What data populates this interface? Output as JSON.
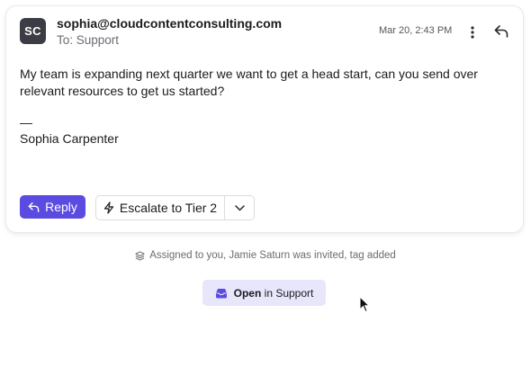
{
  "message": {
    "avatar_initials": "SC",
    "sender_email": "sophia@cloudcontentconsulting.com",
    "recipient": "To: Support",
    "timestamp": "Mar 20, 2:43 PM",
    "body": "My team is expanding next quarter we want to get a head start, can you send over relevant resources to get us started?",
    "signature_dash": "—",
    "signature_name": "Sophia Carpenter"
  },
  "actions": {
    "reply_label": "Reply",
    "escalate_label": "Escalate to Tier 2"
  },
  "activity": {
    "text": "Assigned to you, Jamie Saturn was invited, tag added"
  },
  "open_button": {
    "strong": "Open",
    "rest": " in Support"
  },
  "colors": {
    "accent": "#5b4be0",
    "accent_light": "#e7e6fb",
    "avatar_bg": "#3c3c44"
  }
}
